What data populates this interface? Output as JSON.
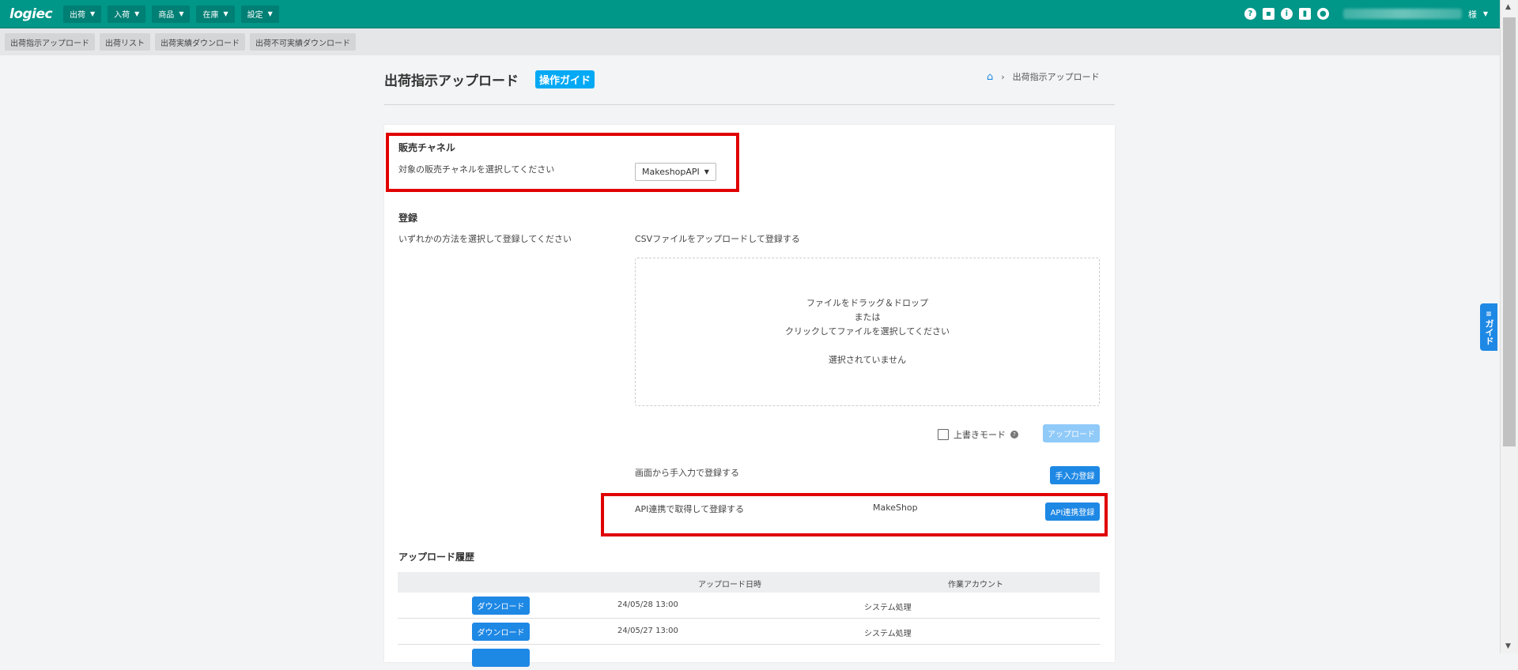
{
  "nav": {
    "logo": "logiec",
    "items": [
      {
        "label": "出荷"
      },
      {
        "label": "入荷"
      },
      {
        "label": "商品"
      },
      {
        "label": "在庫"
      },
      {
        "label": "設定"
      }
    ],
    "user_suffix": "様"
  },
  "subnav": {
    "items": [
      "出荷指示アップロード",
      "出荷リスト",
      "出荷実績ダウンロード",
      "出荷不可実績ダウンロード"
    ]
  },
  "header": {
    "title": "出荷指示アップロード",
    "guide_label": "操作ガイド",
    "breadcrumb_current": "出荷指示アップロード"
  },
  "channel": {
    "title": "販売チャネル",
    "description": "対象の販売チャネルを選択してください",
    "selected": "MakeshopAPI"
  },
  "register": {
    "title": "登録",
    "description": "いずれかの方法を選択して登録してください",
    "csv_label": "CSVファイルをアップロードして登録する",
    "drop_line1": "ファイルをドラッグ＆ドロップ",
    "drop_line2": "または",
    "drop_line3": "クリックしてファイルを選択してください",
    "drop_status": "選択されていません",
    "overwrite_label": "上書きモード",
    "upload_button": "アップロード",
    "manual_label": "画面から手入力で登録する",
    "manual_button": "手入力登録",
    "api_label": "API連携で取得して登録する",
    "api_service": "MakeShop",
    "api_button": "API連携登録"
  },
  "history": {
    "title": "アップロード履歴",
    "columns": [
      "",
      "アップロード日時",
      "作業アカウント"
    ],
    "rows": [
      {
        "button": "ダウンロード",
        "datetime": "24/05/28 13:00",
        "account": "システム処理"
      },
      {
        "button": "ダウンロード",
        "datetime": "24/05/27 13:00",
        "account": "システム処理"
      }
    ]
  },
  "side_tab": {
    "label": "ガイド"
  },
  "colors": {
    "topbar": "#009688",
    "accent": "#1e88e5",
    "guide_badge": "#03a9f4",
    "highlight": "#e00000"
  }
}
